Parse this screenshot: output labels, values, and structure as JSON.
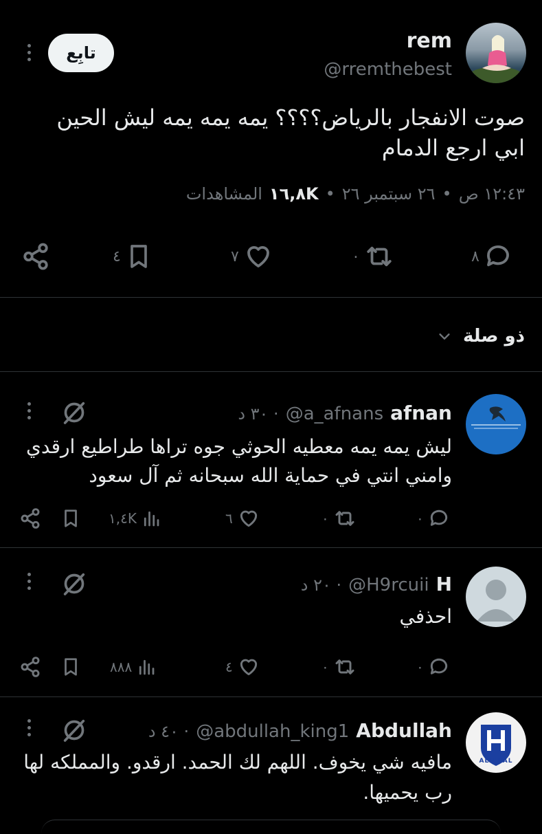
{
  "main_tweet": {
    "author_name": "rem",
    "handle": "@rremthebest",
    "follow_label": "تابِع",
    "text_line1": "صوت الانفجار بالرياض؟؟؟؟ يمه يمه يمه ليش الحين",
    "text_line2": "ابي ارجع الدمام",
    "time": "١٢:٤٣ ص",
    "date": "٢٦ سبتمبر ٢٦",
    "views_count": "١٦,٨K",
    "views_label": "المشاهدات",
    "dot": "•",
    "reply_count": "٨",
    "repost_count": "٠",
    "like_count": "٧",
    "bookmark_count": "٤",
    "icons": [
      "reply-icon",
      "repost-icon",
      "like-icon",
      "bookmark-icon",
      "share-icon"
    ]
  },
  "related_header": {
    "label": "ذو صلة"
  },
  "replies": [
    {
      "name": "afnan",
      "handle": "@a_afnans",
      "meta": "· ٣٠ د",
      "text_line1": "ليش يمه يمه معطيه الحوثي جوه تراها طراطيع ارقدي",
      "text_line2": "وامني انتي في حماية الله سبحانه ثم آل سعود",
      "reply_count": "٠",
      "repost_count": "٠",
      "like_count": "٦",
      "views_count": "١,٤K"
    },
    {
      "name": "H",
      "handle": "@H9rcuii",
      "meta": "· ٢٠ د",
      "text_line1": "احذفي",
      "reply_count": "٠",
      "repost_count": "٠",
      "like_count": "٤",
      "views_count": "٨٨٨"
    },
    {
      "name": "Abdullah",
      "handle": "@abdullah_king1",
      "meta": "· ٤٠ د",
      "text_line1": "مافيه شي يخوف. اللهم لك الحمد.  ارقدو. والمملكه لها",
      "text_line2": "رب يحميها.",
      "avatar_text": "ALHILAL"
    }
  ],
  "colors": {
    "background": "#000000",
    "text": "#e7e9ea",
    "muted": "#71767b",
    "divider": "#2f3336",
    "hilal_blue": "#1b3fa0"
  }
}
